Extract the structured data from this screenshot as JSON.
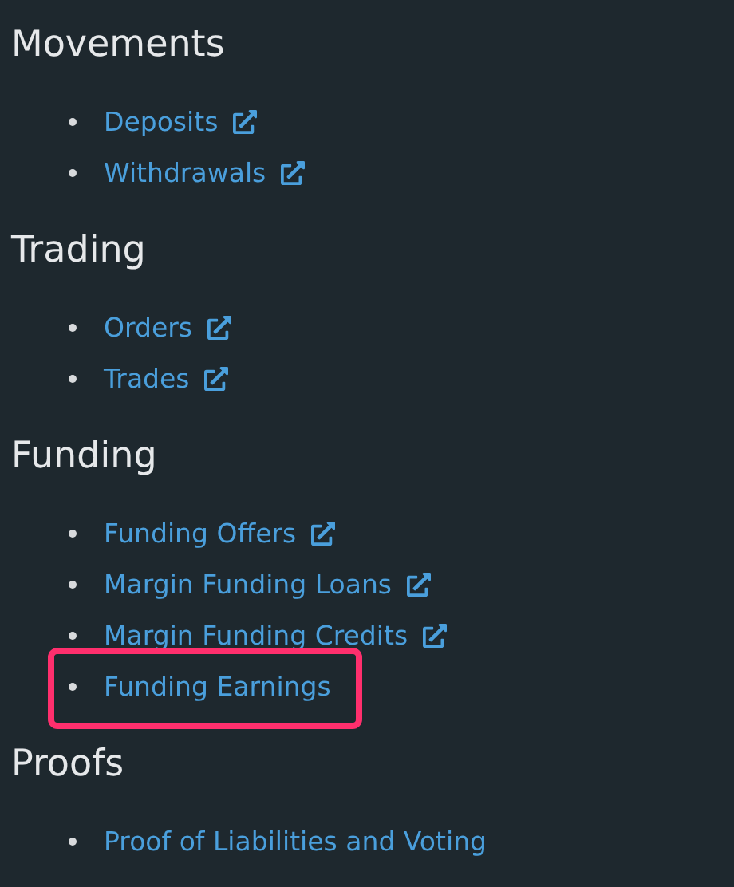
{
  "sections": [
    {
      "heading": "Movements",
      "items": [
        {
          "label": "Deposits",
          "external": true,
          "highlighted": false
        },
        {
          "label": "Withdrawals",
          "external": true,
          "highlighted": false
        }
      ]
    },
    {
      "heading": "Trading",
      "items": [
        {
          "label": "Orders",
          "external": true,
          "highlighted": false
        },
        {
          "label": "Trades",
          "external": true,
          "highlighted": false
        }
      ]
    },
    {
      "heading": "Funding",
      "items": [
        {
          "label": "Funding Offers",
          "external": true,
          "highlighted": false
        },
        {
          "label": "Margin Funding Loans",
          "external": true,
          "highlighted": false
        },
        {
          "label": "Margin Funding Credits",
          "external": true,
          "highlighted": false
        },
        {
          "label": "Funding Earnings",
          "external": false,
          "highlighted": true
        }
      ]
    },
    {
      "heading": "Proofs",
      "items": [
        {
          "label": "Proof of Liabilities and Voting",
          "external": false,
          "highlighted": false
        }
      ]
    }
  ]
}
